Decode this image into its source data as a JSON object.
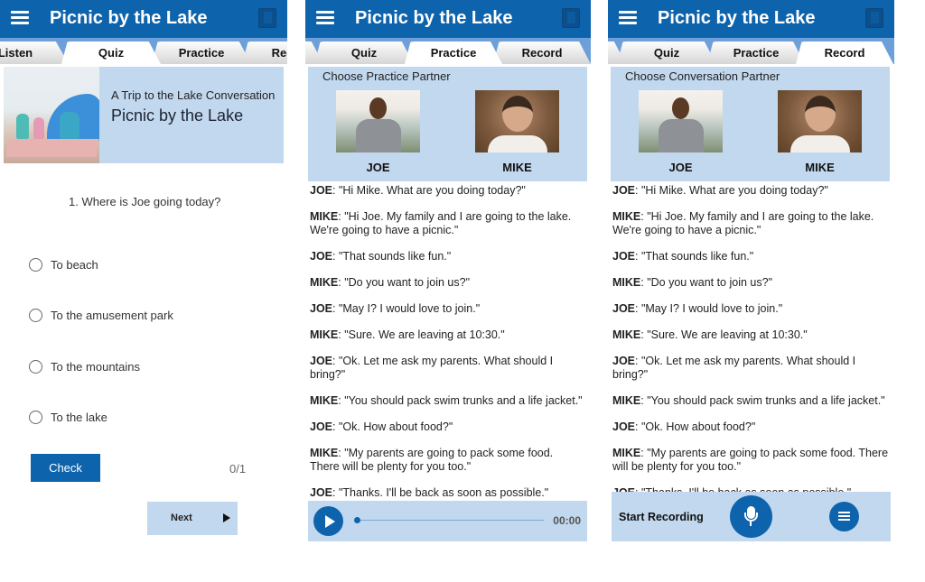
{
  "app": {
    "title": "Picnic by the Lake"
  },
  "colors": {
    "primary": "#0e63ad",
    "tab_strip": "#6da0d9",
    "light_panel": "#c2d8ee"
  },
  "quiz_screen": {
    "tabs": [
      {
        "label": "Listen",
        "active": false
      },
      {
        "label": "Quiz",
        "active": true
      },
      {
        "label": "Practice",
        "active": false
      },
      {
        "label": "Record",
        "active": false
      }
    ],
    "lesson": {
      "subtitle": "A Trip to the Lake Conversation",
      "title": "Picnic by the Lake",
      "image": "family-picnic-beach-photo"
    },
    "question": "1. Where is Joe going today?",
    "options": [
      {
        "label": "To beach",
        "selected": false
      },
      {
        "label": "To the amusement park",
        "selected": false
      },
      {
        "label": "To the mountains",
        "selected": false
      },
      {
        "label": "To the lake",
        "selected": false
      }
    ],
    "check_label": "Check",
    "score": "0/1",
    "next_label": "Next"
  },
  "practice_screen": {
    "tabs": [
      {
        "label": "Quiz",
        "active": false
      },
      {
        "label": "Practice",
        "active": true
      },
      {
        "label": "Record",
        "active": false
      }
    ],
    "partner_heading": "Choose Practice Partner",
    "partners": [
      {
        "name": "JOE"
      },
      {
        "name": "MIKE"
      }
    ],
    "player": {
      "time": "00:00",
      "progress": 0
    }
  },
  "record_screen": {
    "tabs": [
      {
        "label": "Quiz",
        "active": false
      },
      {
        "label": "Practice",
        "active": false
      },
      {
        "label": "Record",
        "active": true
      }
    ],
    "partner_heading": "Choose Conversation Partner",
    "partners": [
      {
        "name": "JOE"
      },
      {
        "name": "MIKE"
      }
    ],
    "record_label": "Start Recording"
  },
  "dialogue": [
    {
      "speaker": "JOE",
      "text": ":  \"Hi Mike.  What are you doing today?\""
    },
    {
      "speaker": "MIKE",
      "text": ":  \"Hi Joe.  My family and I are going to the lake.  We're going to have a picnic.\""
    },
    {
      "speaker": "JOE",
      "text": ":  \"That sounds like fun.\""
    },
    {
      "speaker": "MIKE",
      "text": ":  \"Do you want to join us?\""
    },
    {
      "speaker": "JOE",
      "text": ":  \"May I?  I would love to join.\""
    },
    {
      "speaker": "MIKE",
      "text": ":  \"Sure.  We are leaving at 10:30.\""
    },
    {
      "speaker": "JOE",
      "text": ":  \"Ok.  Let me ask my parents.  What should I bring?\""
    },
    {
      "speaker": "MIKE",
      "text": ":  \"You should pack swim trunks and a life jacket.\""
    },
    {
      "speaker": "JOE",
      "text": ":  \"Ok.  How about food?\""
    },
    {
      "speaker": "MIKE",
      "text": ":  \"My parents are going to pack some food.  There will be plenty for you too.\""
    },
    {
      "speaker": "JOE",
      "text": ":  \"Thanks.  I'll be back as soon as possible.\""
    }
  ]
}
